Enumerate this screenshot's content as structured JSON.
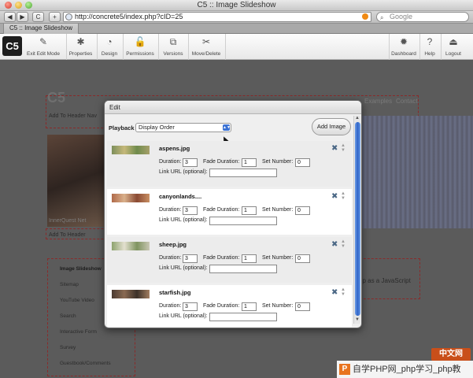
{
  "window": {
    "title": "C5 :: Image Slideshow"
  },
  "browser": {
    "back_label": "◀",
    "forward_label": "▶",
    "reload_label": "C",
    "add_label": "+",
    "url": "http://concrete5/index.php?cID=25",
    "search_placeholder": "Google",
    "tab_title": "C5 :: Image Slideshow"
  },
  "c5_toolbar": {
    "logo": "C5",
    "items": [
      {
        "label": "Exit Edit Mode",
        "icon": "exit-edit-icon",
        "glyph": "✎"
      },
      {
        "label": "Properties",
        "icon": "properties-icon",
        "glyph": "✱"
      },
      {
        "label": "Design",
        "icon": "design-icon",
        "glyph": "◔"
      },
      {
        "label": "Permissions",
        "icon": "permissions-icon",
        "glyph": "🔓"
      },
      {
        "label": "Versions",
        "icon": "versions-icon",
        "glyph": "⧉"
      },
      {
        "label": "Move/Delete",
        "icon": "move-delete-icon",
        "glyph": "✂"
      }
    ],
    "right_items": [
      {
        "label": "Dashboard",
        "icon": "dashboard-icon",
        "glyph": "✹"
      },
      {
        "label": "Help",
        "icon": "help-icon",
        "glyph": "?"
      },
      {
        "label": "Logout",
        "icon": "logout-icon",
        "glyph": "⏏"
      }
    ]
  },
  "background_page": {
    "logo": "C5",
    "add_to_header_nav": "Add To Header Nav",
    "nav_examples": "Examples",
    "nav_contact": "Contact",
    "hero_caption": "InnerQuest Net",
    "add_to_header": "Add To Header",
    "side_nav": [
      "Image Slideshow",
      "Sitemap",
      "YouTube Video",
      "Search",
      "Interactive Form",
      "Survey",
      "Guestbook/Comments"
    ],
    "right_text": "up as a JavaScript"
  },
  "dialog": {
    "title": "Edit",
    "playback_label": "Playback",
    "playback_value": "Display Order",
    "add_image_label": "Add Image",
    "labels": {
      "duration": "Duration:",
      "fade_duration": "Fade Duration:",
      "set_number": "Set Number:",
      "link_url": "Link URL (optional):"
    },
    "images": [
      {
        "file": "aspens.jpg",
        "duration": "3",
        "fade_duration": "1",
        "set_number": "0",
        "link_url": ""
      },
      {
        "file": "canyonlands....",
        "duration": "3",
        "fade_duration": "1",
        "set_number": "0",
        "link_url": ""
      },
      {
        "file": "sheep.jpg",
        "duration": "3",
        "fade_duration": "1",
        "set_number": "0",
        "link_url": ""
      },
      {
        "file": "starfish.jpg",
        "duration": "3",
        "fade_duration": "1",
        "set_number": "0",
        "link_url": ""
      }
    ]
  },
  "watermark": {
    "badge": "中文网",
    "text": "自学PHP网_php学习_php教"
  },
  "colors": {
    "scroll_accent": "#2f64c8",
    "c5_logo_bg": "#1d1d1d"
  }
}
